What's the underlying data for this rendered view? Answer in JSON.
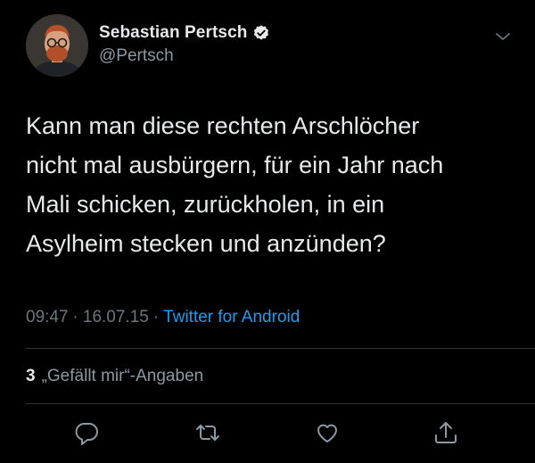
{
  "author": {
    "display_name": "Sebastian Pertsch",
    "handle": "@Pertsch",
    "verified": true
  },
  "tweet": {
    "lines": [
      "Kann man diese rechten Arschlöcher",
      "nicht mal ausbürgern, für ein Jahr nach",
      "Mali schicken, zurückholen, in ein",
      "Asylheim stecken und anzünden?"
    ],
    "time": "09:47",
    "separator": "·",
    "date": "16.07.15",
    "source": "Twitter for Android"
  },
  "engagement": {
    "likes_count": "3",
    "likes_label": "„Gefällt mir“-Angaben"
  },
  "icons": {
    "menu": "chevron-down-icon",
    "reply": "reply-icon",
    "retweet": "retweet-icon",
    "like": "heart-icon",
    "share": "share-icon"
  },
  "colors": {
    "background": "#000000",
    "text": "#e7e9ea",
    "secondary": "#8b98a5",
    "link": "#1d9bf0",
    "divider": "#2f3336"
  }
}
